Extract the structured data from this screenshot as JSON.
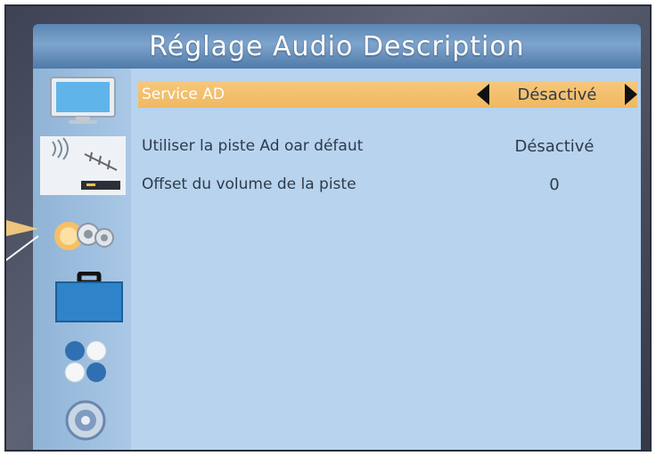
{
  "header": {
    "title": "Réglage Audio Description"
  },
  "sidebar": {
    "items": [
      {
        "name": "tv-icon"
      },
      {
        "name": "antenna-icon"
      },
      {
        "name": "gears-icon",
        "selected": true
      },
      {
        "name": "briefcase-icon"
      },
      {
        "name": "balls-icon"
      },
      {
        "name": "disc-icon"
      }
    ]
  },
  "settings": {
    "rows": [
      {
        "label": "Service AD",
        "value": "Désactivé",
        "selected": true
      },
      {
        "label": "Utiliser la piste Ad oar défaut",
        "value": "Désactivé"
      },
      {
        "label": "Offset du volume de la piste",
        "value": "0"
      }
    ]
  },
  "colors": {
    "highlight": "#f2bc6a",
    "content_bg": "#b7d3ee",
    "header_bg": "#6a93c0"
  }
}
